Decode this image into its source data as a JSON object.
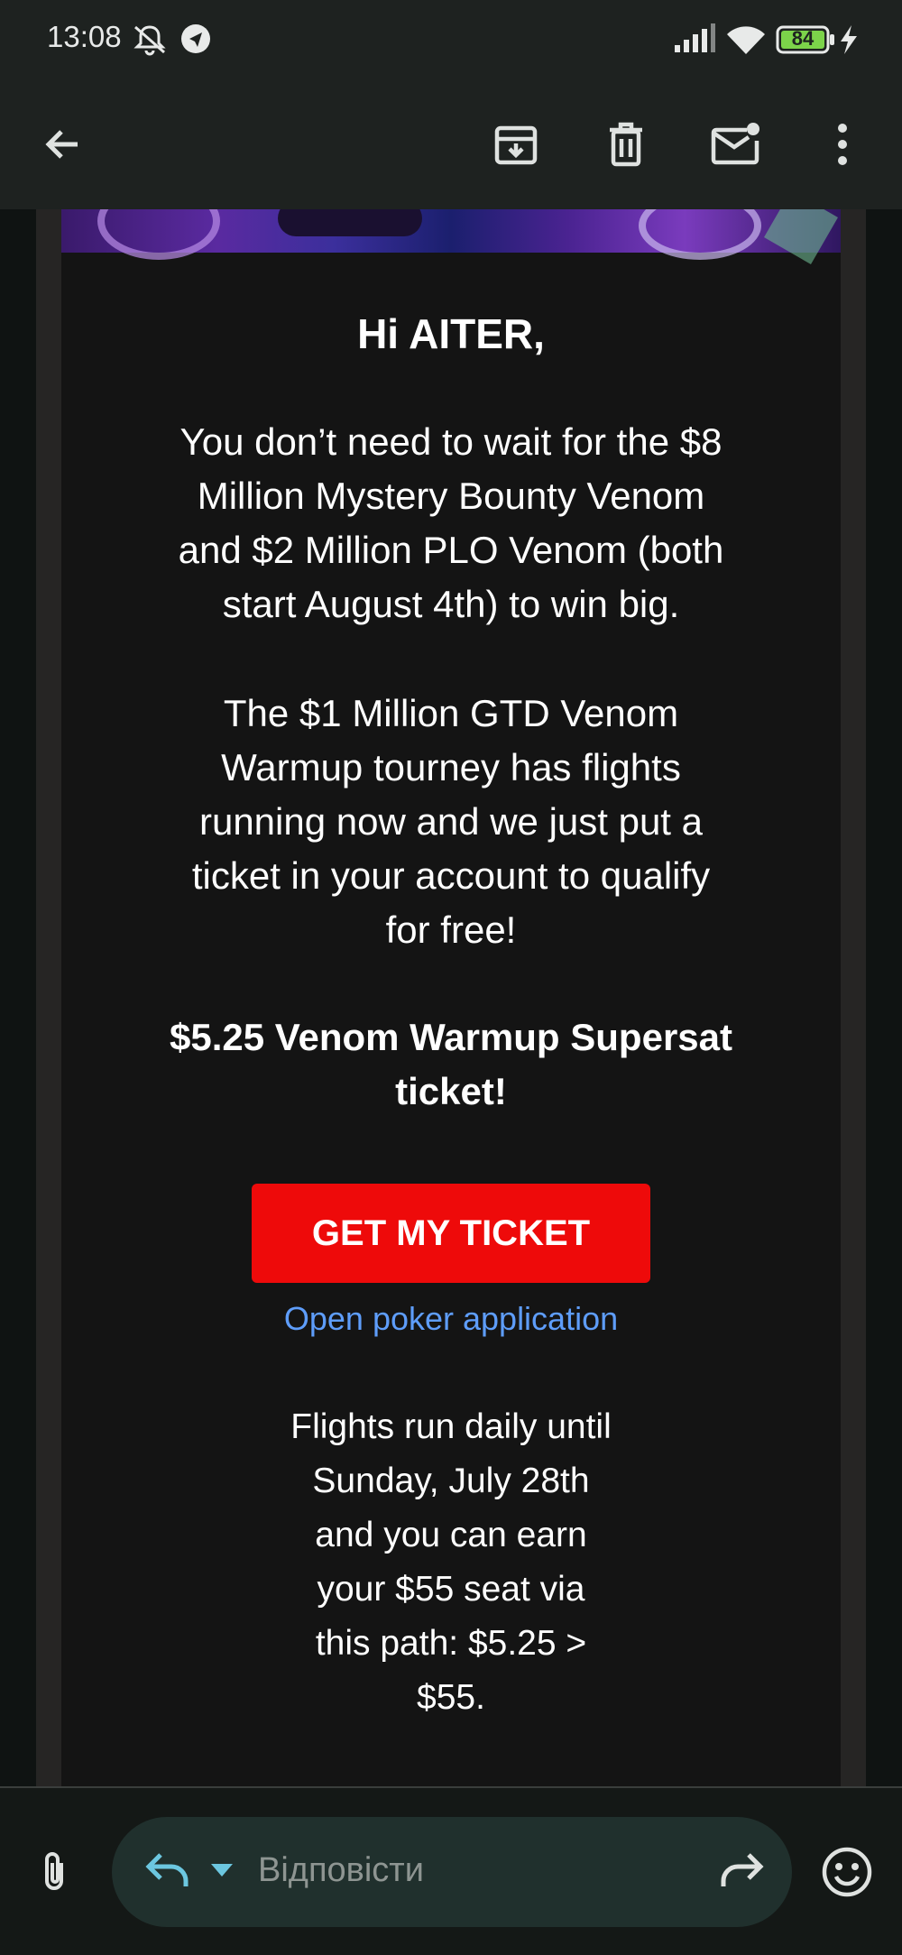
{
  "status_bar": {
    "time": "13:08",
    "battery_level": "84",
    "icons": [
      "mute-icon",
      "location-icon",
      "signal-icon",
      "wifi-icon",
      "battery-icon",
      "charging-icon"
    ]
  },
  "app_bar": {
    "icons": [
      "back-arrow-icon",
      "archive-icon",
      "delete-icon",
      "mark-unread-icon",
      "more-vert-icon"
    ]
  },
  "email": {
    "greeting": "Hi AITER,",
    "paragraph1": "You don’t need to wait for the $8\nMillion Mystery Bounty Venom\nand $2 Million PLO Venom (both\nstart August 4th) to win big.",
    "paragraph2": "The $1 Million GTD Venom\nWarmup tourney has flights\nrunning now and we just put a\nticket in your account to qualify\nfor free!",
    "offer": "$5.25 Venom Warmup Supersat\nticket!",
    "cta_label": "GET MY TICKET",
    "app_link": "Open poker application",
    "paragraph3": "Flights run daily until\nSunday, July 28th\nand you can earn\nyour $55 seat via\nthis path: $5.25 >\n$55."
  },
  "reply_bar": {
    "placeholder": "Відповісти",
    "icons": [
      "attachment-icon",
      "reply-icon",
      "dropdown-caret-icon",
      "forward-icon",
      "emoji-icon"
    ]
  },
  "colors": {
    "cta": "#ee0a0a",
    "link": "#5e9dfa",
    "background": "#0f1312",
    "bar": "#1e2220",
    "battery": "#7cd34a"
  }
}
